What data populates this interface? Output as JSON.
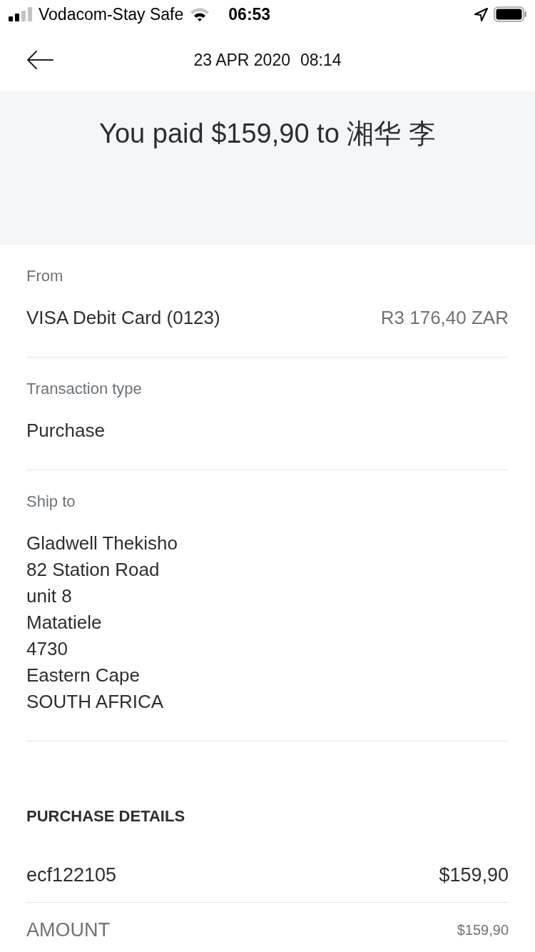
{
  "status_bar": {
    "carrier": "Vodacom-Stay Safe",
    "time": "06:53"
  },
  "header": {
    "date": "23 APR 2020",
    "time": "08:14"
  },
  "summary": {
    "text": "You paid $159,90 to 湘华 李"
  },
  "sections": [
    {
      "label": "From",
      "lines": [
        "VISA Debit Card (0123)"
      ],
      "value": "R3 176,40 ZAR"
    },
    {
      "label": "Transaction type",
      "lines": [
        "Purchase"
      ]
    },
    {
      "label": "Ship to",
      "lines": [
        "Gladwell Thekisho",
        "82 Station Road",
        "unit 8",
        "Matatiele",
        "4730",
        "Eastern Cape",
        "SOUTH AFRICA"
      ]
    }
  ],
  "purchase_details": {
    "title": "PURCHASE DETAILS",
    "items": [
      {
        "kind": "item",
        "name": "ecf122105",
        "amount": "$159,90"
      },
      {
        "kind": "total",
        "name": "AMOUNT",
        "amount": "$159,90"
      }
    ]
  }
}
